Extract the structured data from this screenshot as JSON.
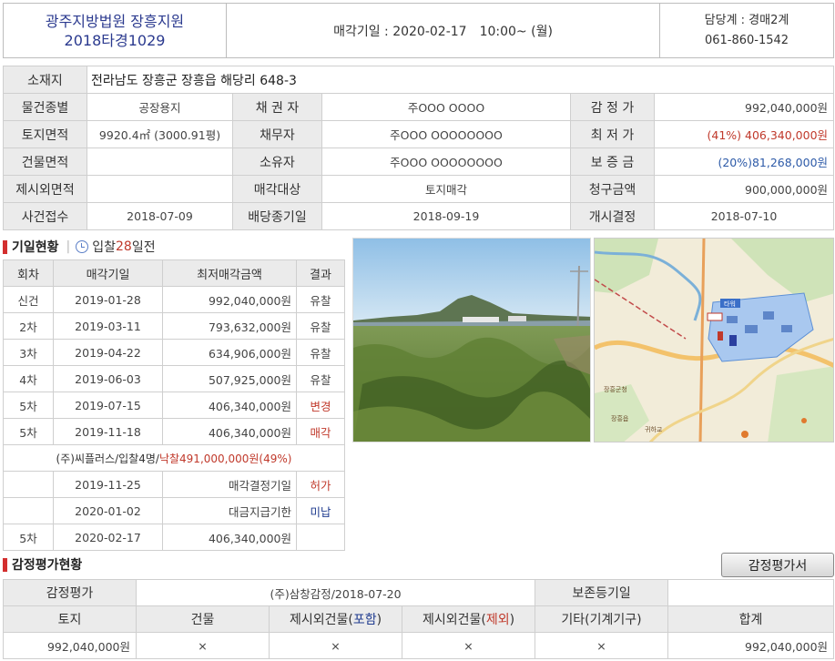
{
  "header": {
    "court": "광주지방법원 장흥지원",
    "case_no": "2018타경1029",
    "sale_date_label": "매각기일 : 2020-02-17　10:00~ (월)",
    "dept": "담당계 : 경매2계",
    "phone": "061-860-1542"
  },
  "info": {
    "address_label": "소재지",
    "address": "전라남도 장흥군 장흥읍 해당리 648-3",
    "rows": [
      [
        "물건종별",
        "공장용지",
        "채 권 자",
        "주OOO OOOO",
        "감 정 가",
        "992,040,000원"
      ],
      [
        "토지면적",
        "9920.4㎡ (3000.91평)",
        "채무자",
        "주OOO OOOOOOOO",
        "최 저 가",
        "(41%) 406,340,000원"
      ],
      [
        "건물면적",
        "",
        "소유자",
        "주OOO OOOOOOOO",
        "보 증 금",
        "(20%)81,268,000원"
      ],
      [
        "제시외면적",
        "",
        "매각대상",
        "토지매각",
        "청구금액",
        "900,000,000원"
      ],
      [
        "사건접수",
        "2018-07-09",
        "배당종기일",
        "2018-09-19",
        "개시결정",
        "2018-07-10"
      ]
    ]
  },
  "history": {
    "title": "기일현황",
    "sub_prefix": "입찰",
    "sub_days": "28",
    "sub_suffix": "일전",
    "headers": [
      "회차",
      "매각기일",
      "최저매각금액",
      "결과"
    ],
    "rows": [
      [
        "신건",
        "2019-01-28",
        "992,040,000원",
        "유찰"
      ],
      [
        "2차",
        "2019-03-11",
        "793,632,000원",
        "유찰"
      ],
      [
        "3차",
        "2019-04-22",
        "634,906,000원",
        "유찰"
      ],
      [
        "4차",
        "2019-06-03",
        "507,925,000원",
        "유찰"
      ],
      [
        "5차",
        "2019-07-15",
        "406,340,000원",
        "변경"
      ],
      [
        "5차",
        "2019-11-18",
        "406,340,000원",
        "매각"
      ]
    ],
    "note_prefix": "(주)씨플러스/입찰4명/",
    "note_price": "낙찰491,000,000원(49%)",
    "extra_rows": [
      [
        "",
        "2019-11-25",
        "매각결정기일",
        "허가"
      ],
      [
        "",
        "2020-01-02",
        "대금지급기한",
        "미납"
      ],
      [
        "5차",
        "2020-02-17",
        "406,340,000원",
        ""
      ]
    ]
  },
  "map": {
    "labels": [
      "장흥군청",
      "장흥읍",
      "귀하교",
      "타워"
    ]
  },
  "appraisal": {
    "title": "감정평가현황",
    "button": "감정평가서",
    "row1_label": "감정평가",
    "row1_value": "(주)삼창감정/2018-07-20",
    "row1_label2": "보존등기일",
    "row1_value2": "",
    "head_land": "토지",
    "head_building": "건물",
    "head_ext_in_prefix": "제시외건물(",
    "head_ext_in_word": "포함",
    "head_ext_out_prefix": "제시외건물(",
    "head_ext_out_word": "제외",
    "head_close": ")",
    "head_etc": "기타(기계기구)",
    "head_total": "합계",
    "values": [
      "992,040,000원",
      "×",
      "×",
      "×",
      "×",
      "992,040,000원"
    ]
  },
  "colors": {
    "accent_red": "#c0392b",
    "accent_blue": "#2d5aa8",
    "court_blue": "#2b3a8f",
    "label_bg": "#ebebeb"
  }
}
